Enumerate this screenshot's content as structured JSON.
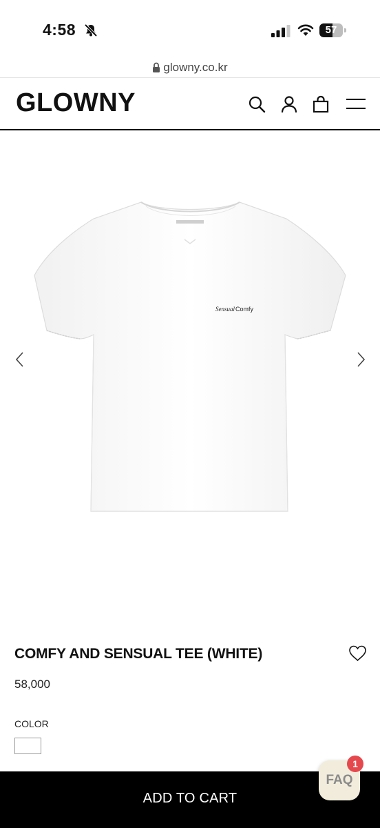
{
  "status_bar": {
    "time": "4:58",
    "battery": "57",
    "battery_level": 0.57
  },
  "browser": {
    "url": "glowny.co.kr"
  },
  "header": {
    "logo": "GLOWNY"
  },
  "product_image": {
    "print_text_script": "Sensual",
    "print_text_sans": "Comfy"
  },
  "product": {
    "title": "COMFY AND SENSUAL TEE (WHITE)",
    "price": "58,000",
    "color_label": "COLOR",
    "selected_color": "#ffffff"
  },
  "actions": {
    "add_to_cart": "ADD TO CART"
  },
  "faq": {
    "label": "FAQ",
    "badge_count": "1"
  },
  "colors": {
    "accent": "#000000",
    "badge": "#e5484d",
    "faq_bg": "#f2ecdc"
  }
}
